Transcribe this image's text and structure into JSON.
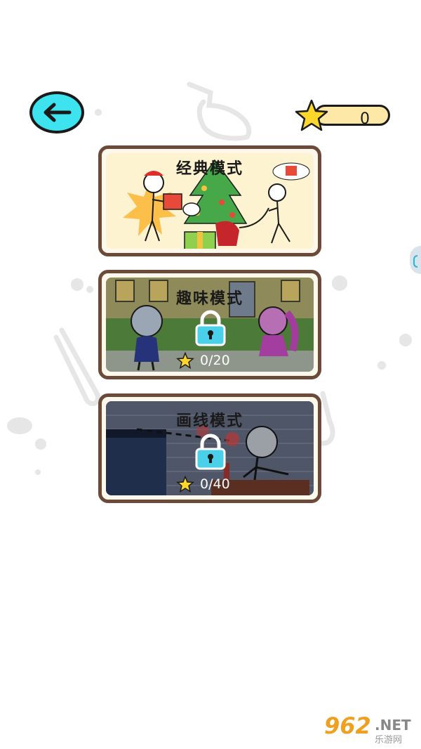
{
  "header": {
    "back_icon": "arrow-left-icon",
    "star_icon": "star-icon",
    "star_count": "0"
  },
  "modes": [
    {
      "title": "经典模式",
      "locked": false
    },
    {
      "title": "趣味模式",
      "locked": true,
      "progress": "0/20"
    },
    {
      "title": "画线模式",
      "locked": true,
      "progress": "0/40"
    }
  ],
  "watermark": {
    "number": "962",
    "net": ".NET",
    "site": "乐游网"
  },
  "colors": {
    "back_button": "#3ee3f0",
    "card_border": "#6b4a3a",
    "star": "#fcd72a",
    "lock": "#4ad0e8"
  }
}
